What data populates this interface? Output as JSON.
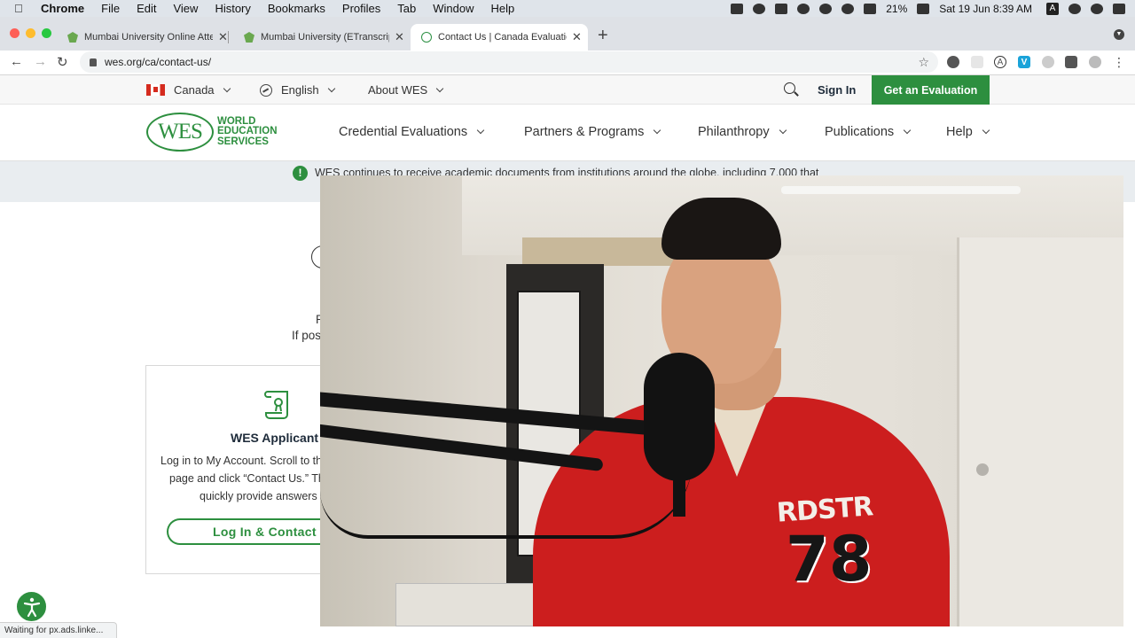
{
  "menubar": {
    "app": "Chrome",
    "items": [
      "File",
      "Edit",
      "View",
      "History",
      "Bookmarks",
      "Profiles",
      "Tab",
      "Window",
      "Help"
    ],
    "battery": "21%",
    "datetime": "Sat 19 Jun  8:39 AM",
    "input_indicator": "A"
  },
  "tabs": [
    {
      "title": "Mumbai University Online Atte",
      "favicon": "green-shield-icon"
    },
    {
      "title": "Mumbai University (ETranscrip",
      "favicon": "green-shield-icon"
    },
    {
      "title": "Contact Us | Canada Evaluatio",
      "favicon": "wes-icon",
      "active": true
    }
  ],
  "toolbar": {
    "url": "wes.org/ca/contact-us/"
  },
  "utility": {
    "country": "Canada",
    "language": "English",
    "about": "About WES",
    "signin": "Sign In",
    "cta": "Get an Evaluation"
  },
  "logo": {
    "mark": "WES",
    "line1": "WORLD",
    "line2": "EDUCATION",
    "line3": "SERVICES"
  },
  "nav": [
    "Credential Evaluations",
    "Partners & Programs",
    "Philanthropy",
    "Publications",
    "Help"
  ],
  "alert": {
    "icon": "!",
    "text": "WES continues to receive academic documents from institutions around the globe, including 7,000 that"
  },
  "body": {
    "line_a": "P",
    "line_b": "If pos"
  },
  "card": {
    "title": "WES Applicant",
    "line1": "Log in to My Account. Scroll to th",
    "line2": "page and click “Contact Us.” Th",
    "line3": "quickly provide answers",
    "button": "Log In & Contact"
  },
  "status": "Waiting for px.ads.linke...",
  "webcam": {
    "shirt_text_top": "RDSTR",
    "shirt_text_number": "78"
  },
  "colors": {
    "brand_green": "#2d8f3f",
    "shirt_red": "#cc1e1e"
  }
}
